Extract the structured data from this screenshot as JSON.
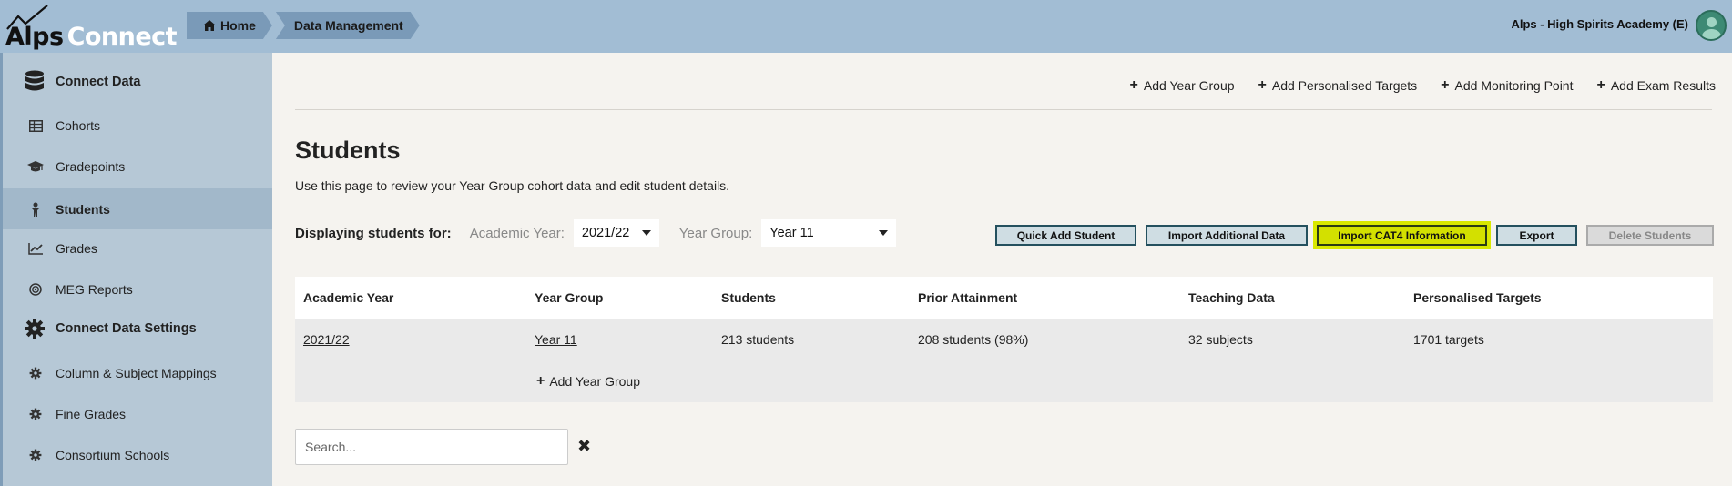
{
  "header": {
    "logo_part1": "Alps",
    "logo_part2": "Connect",
    "breadcrumbs": [
      "Home",
      "Data Management"
    ],
    "school": "Alps - High Spirits Academy (E)"
  },
  "sidebar": {
    "items": [
      {
        "label": "Connect Data",
        "icon": "database-icon",
        "type": "header"
      },
      {
        "label": "Cohorts",
        "icon": "table-icon"
      },
      {
        "label": "Gradepoints",
        "icon": "graduation-cap-icon"
      },
      {
        "label": "Students",
        "icon": "student-icon",
        "active": true
      },
      {
        "label": "Grades",
        "icon": "line-chart-icon"
      },
      {
        "label": "MEG Reports",
        "icon": "target-icon"
      },
      {
        "label": "Connect Data Settings",
        "icon": "gear-icon",
        "type": "header"
      },
      {
        "label": "Column & Subject Mappings",
        "icon": "gear-icon"
      },
      {
        "label": "Fine Grades",
        "icon": "gear-icon"
      },
      {
        "label": "Consortium Schools",
        "icon": "gear-icon"
      }
    ]
  },
  "actions": {
    "add_year_group": "Add Year Group",
    "add_personalised_targets": "Add Personalised Targets",
    "add_monitoring_point": "Add Monitoring Point",
    "add_exam_results": "Add Exam Results"
  },
  "page": {
    "title": "Students",
    "description": "Use this page to review your Year Group cohort data and edit student details."
  },
  "filters": {
    "displaying_label": "Displaying students for:",
    "academic_year_label": "Academic Year:",
    "academic_year_value": "2021/22",
    "year_group_label": "Year Group:",
    "year_group_value": "Year 11"
  },
  "buttons": {
    "quick_add": "Quick Add Student",
    "import_additional": "Import Additional Data",
    "import_cat4": "Import CAT4 Information",
    "export": "Export",
    "delete": "Delete Students"
  },
  "table": {
    "columns": [
      "Academic Year",
      "Year Group",
      "Students",
      "Prior Attainment",
      "Teaching Data",
      "Personalised Targets"
    ],
    "rows": [
      [
        "2021/22",
        "Year 11",
        "213 students",
        "208 students (98%)",
        "32 subjects",
        "1701 targets"
      ]
    ],
    "add_year_group": "Add Year Group"
  },
  "search": {
    "placeholder": "Search..."
  },
  "colors": {
    "topbar": "#a2bdd4",
    "sidebar": "#b6c8d6",
    "highlight": "#d3e000"
  }
}
